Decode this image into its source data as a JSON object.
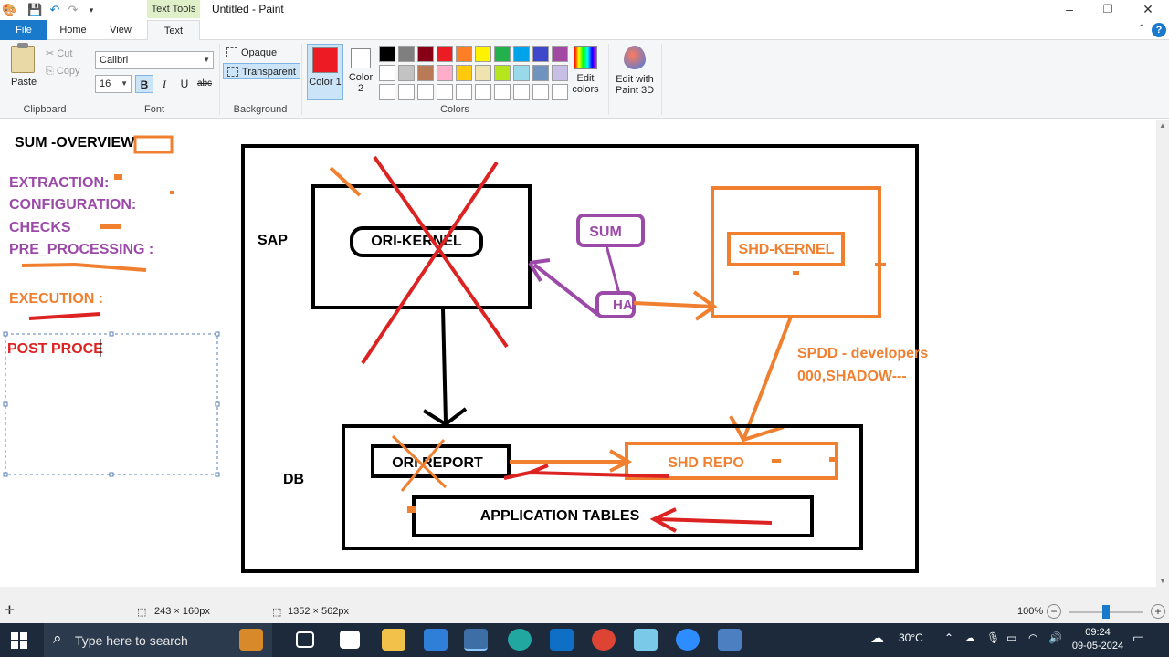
{
  "window": {
    "title": "Untitled - Paint",
    "context_tab": "Text Tools",
    "controls": [
      "minimize",
      "restore",
      "close"
    ]
  },
  "tabs": [
    "File",
    "Home",
    "View",
    "Text"
  ],
  "active_tab": "Text",
  "ribbon": {
    "clipboard": {
      "label": "Clipboard",
      "paste": "Paste",
      "cut": "Cut",
      "copy": "Copy"
    },
    "font": {
      "label": "Font",
      "family": "Calibri",
      "size": "16",
      "bold": "B",
      "italic": "I",
      "underline": "U",
      "strike": "abc"
    },
    "background": {
      "label": "Background",
      "opaque": "Opaque",
      "transparent": "Transparent",
      "selected": "Transparent"
    },
    "colors": {
      "label": "Colors",
      "color1_label": "Color 1",
      "color2_label": "Color 2",
      "color1": "#ed1c24",
      "color2": "#ffffff",
      "palette_row1": [
        "#000000",
        "#7f7f7f",
        "#880015",
        "#ed1c24",
        "#ff7f27",
        "#fff200",
        "#22b14c",
        "#00a2e8",
        "#3f48cc",
        "#a349a4"
      ],
      "palette_row2": [
        "#ffffff",
        "#c3c3c3",
        "#b97a57",
        "#ffaec9",
        "#ffc90e",
        "#efe4b0",
        "#b5e61d",
        "#99d9ea",
        "#7092be",
        "#c8bfe7"
      ],
      "palette_row3": [
        "#ffffff",
        "#ffffff",
        "#ffffff",
        "#ffffff",
        "#ffffff",
        "#ffffff",
        "#ffffff",
        "#ffffff",
        "#ffffff",
        "#ffffff"
      ],
      "edit_colors": "Edit colors",
      "edit_paint3d": "Edit with Paint 3D"
    }
  },
  "canvas": {
    "notes_title": "SUM -OVERVIEW",
    "notes": [
      "EXTRACTION:",
      "CONFIGURATION:",
      "CHECKS",
      "PRE_PROCESSING :"
    ],
    "execution": "EXECUTION :",
    "text_box_value": "POST PROCE",
    "diagram": {
      "sap_label": "SAP",
      "db_label": "DB",
      "ori_kernel": "ORI-KERNEL",
      "shd_kernel": "SHD-KERNEL",
      "sum": "SUM",
      "ha": "HA",
      "spdd_line1": "SPDD - developers",
      "spdd_line2": "000,SHADOW---",
      "ori_report": "ORI REPORT",
      "shd_repo": "SHD REPO",
      "app_tables": "APPLICATION TABLES"
    }
  },
  "status": {
    "selection_size": "243 × 160px",
    "image_size": "1352 × 562px",
    "zoom": "100%"
  },
  "taskbar": {
    "search_placeholder": "Type here to search",
    "apps": [
      "briefcase-app",
      "task-view",
      "microsoft-store",
      "file-explorer",
      "mail",
      "paint",
      "edge",
      "outlook",
      "chrome",
      "notepad",
      "zoom",
      "remote-desktop"
    ],
    "temperature": "30°C",
    "time": "09:24",
    "date": "09-05-2024"
  }
}
